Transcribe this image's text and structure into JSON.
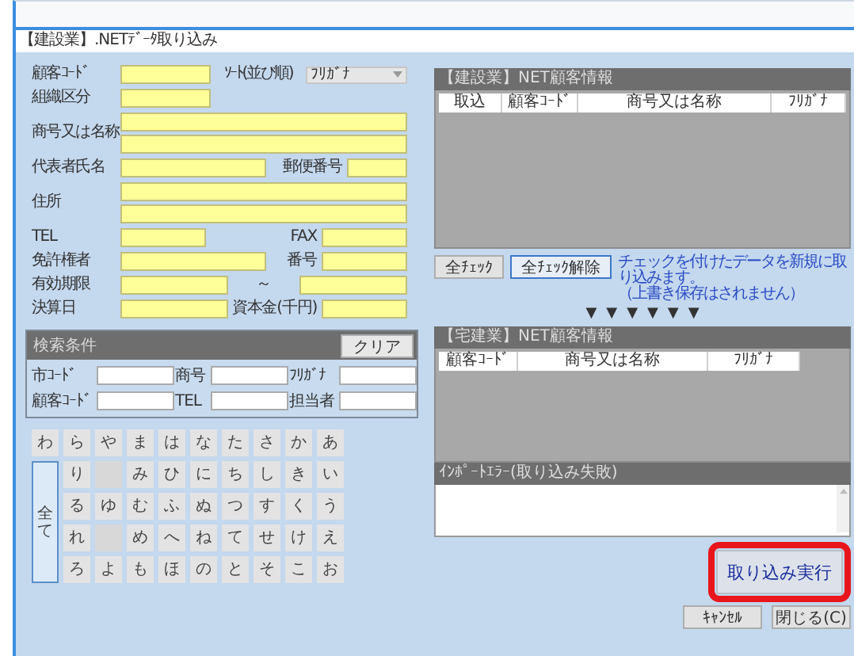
{
  "window": {
    "title": "【建設業】.NETﾃﾞｰﾀ取り込み"
  },
  "form_rows": [
    {
      "label": "顧客ｺｰﾄﾞ",
      "items": [
        {
          "kind": "short"
        },
        {
          "kind": "label",
          "text": "ｿｰﾄ(並び順)"
        },
        {
          "kind": "select",
          "value": "ﾌﾘｶﾞﾅ"
        }
      ]
    },
    {
      "label": "組織区分",
      "items": [
        {
          "kind": "short"
        }
      ]
    },
    {
      "label": "商号又は名称",
      "items": [
        {
          "kind": "wide"
        },
        {
          "kind": "wide"
        }
      ]
    },
    {
      "label": "代表者氏名",
      "items": [
        {
          "kind": "medium"
        },
        {
          "kind": "label",
          "text": "郵便番号"
        },
        {
          "kind": "tiny"
        }
      ]
    },
    {
      "label": "住所",
      "items": [
        {
          "kind": "wide"
        },
        {
          "kind": "wide"
        }
      ]
    },
    {
      "label": "TEL",
      "items": [
        {
          "kind": "small"
        },
        {
          "kind": "label",
          "text": "FAX"
        },
        {
          "kind": "small"
        }
      ]
    },
    {
      "label": "免許権者",
      "items": [
        {
          "kind": "medium"
        },
        {
          "kind": "label",
          "text": "番号"
        },
        {
          "kind": "small"
        }
      ]
    },
    {
      "label": "有効期限",
      "items": [
        {
          "kind": "date"
        },
        {
          "kind": "tilde",
          "text": "～"
        },
        {
          "kind": "date"
        }
      ]
    },
    {
      "label": "決算日",
      "items": [
        {
          "kind": "date"
        },
        {
          "kind": "label",
          "text": "資本金(千円)"
        },
        {
          "kind": "small"
        }
      ]
    }
  ],
  "search": {
    "title": "検索条件",
    "clear_button": "クリア",
    "fields": [
      {
        "label": "市ｺｰﾄﾞ"
      },
      {
        "label": "商号"
      },
      {
        "label": "ﾌﾘｶﾞﾅ"
      },
      {
        "label": "顧客ｺｰﾄﾞ"
      },
      {
        "label": "TEL"
      },
      {
        "label": "担当者"
      }
    ]
  },
  "kana": {
    "rows": [
      [
        {
          "kind": "key",
          "label": "わ"
        },
        {
          "kind": "key",
          "label": "ら"
        },
        {
          "kind": "key",
          "label": "や"
        },
        {
          "kind": "key",
          "label": "ま"
        },
        {
          "kind": "key",
          "label": "は"
        },
        {
          "kind": "key",
          "label": "な"
        },
        {
          "kind": "key",
          "label": "た"
        },
        {
          "kind": "key",
          "label": "さ"
        },
        {
          "kind": "key",
          "label": "か"
        },
        {
          "kind": "key",
          "label": "あ"
        }
      ],
      [
        {
          "kind": "merged"
        },
        {
          "kind": "key",
          "label": "り"
        },
        {
          "kind": "blank"
        },
        {
          "kind": "key",
          "label": "み"
        },
        {
          "kind": "key",
          "label": "ひ"
        },
        {
          "kind": "key",
          "label": "に"
        },
        {
          "kind": "key",
          "label": "ち"
        },
        {
          "kind": "key",
          "label": "し"
        },
        {
          "kind": "key",
          "label": "き"
        },
        {
          "kind": "key",
          "label": "い"
        }
      ],
      [
        {
          "kind": "all",
          "label": "全て"
        },
        {
          "kind": "key",
          "label": "る"
        },
        {
          "kind": "key",
          "label": "ゆ"
        },
        {
          "kind": "key",
          "label": "む"
        },
        {
          "kind": "key",
          "label": "ふ"
        },
        {
          "kind": "key",
          "label": "ぬ"
        },
        {
          "kind": "key",
          "label": "つ"
        },
        {
          "kind": "key",
          "label": "す"
        },
        {
          "kind": "key",
          "label": "く"
        },
        {
          "kind": "key",
          "label": "う"
        }
      ],
      [
        {
          "kind": "merged"
        },
        {
          "kind": "key",
          "label": "れ"
        },
        {
          "kind": "blank"
        },
        {
          "kind": "key",
          "label": "め"
        },
        {
          "kind": "key",
          "label": "へ"
        },
        {
          "kind": "key",
          "label": "ね"
        },
        {
          "kind": "key",
          "label": "て"
        },
        {
          "kind": "key",
          "label": "せ"
        },
        {
          "kind": "key",
          "label": "け"
        },
        {
          "kind": "key",
          "label": "え"
        }
      ],
      [
        {
          "kind": "merged"
        },
        {
          "kind": "key",
          "label": "ろ"
        },
        {
          "kind": "key",
          "label": "よ"
        },
        {
          "kind": "key",
          "label": "も"
        },
        {
          "kind": "key",
          "label": "ほ"
        },
        {
          "kind": "key",
          "label": "の"
        },
        {
          "kind": "key",
          "label": "と"
        },
        {
          "kind": "key",
          "label": "そ"
        },
        {
          "kind": "key",
          "label": "こ"
        },
        {
          "kind": "key",
          "label": "お"
        }
      ]
    ]
  },
  "construction_table": {
    "title": "【建設業】NET顧客情報",
    "columns": [
      {
        "label": "取込"
      },
      {
        "label": "顧客ｺｰﾄﾞ"
      },
      {
        "label": "商号又は名称"
      },
      {
        "label": "ﾌﾘｶﾞﾅ"
      }
    ]
  },
  "check_buttons": [
    {
      "label": "全ﾁｪｯｸ",
      "focused": false
    },
    {
      "label": "全ﾁｪｯｸ解除",
      "focused": true
    }
  ],
  "notice": [
    "チェックを付けたデータを新規に取り込みます。",
    "（上書き保存はされません）"
  ],
  "arrows": [
    "▼",
    "▼",
    "▼",
    "▼",
    "▼",
    "▼"
  ],
  "realestate_table": {
    "title": "【宅建業】NET顧客情報",
    "columns": [
      {
        "label": "顧客ｺｰﾄﾞ"
      },
      {
        "label": "商号又は名称"
      },
      {
        "label": "ﾌﾘｶﾞﾅ"
      }
    ]
  },
  "error_log": {
    "title": "ｲﾝﾎﾟｰﾄｴﾗｰ(取り込み失敗)"
  },
  "execute_button": {
    "label": "取り込み実行",
    "highlighted": true
  },
  "footer_buttons": [
    {
      "label": "ｷｬﾝｾﾙ"
    },
    {
      "label": "閉じる(C)"
    }
  ]
}
